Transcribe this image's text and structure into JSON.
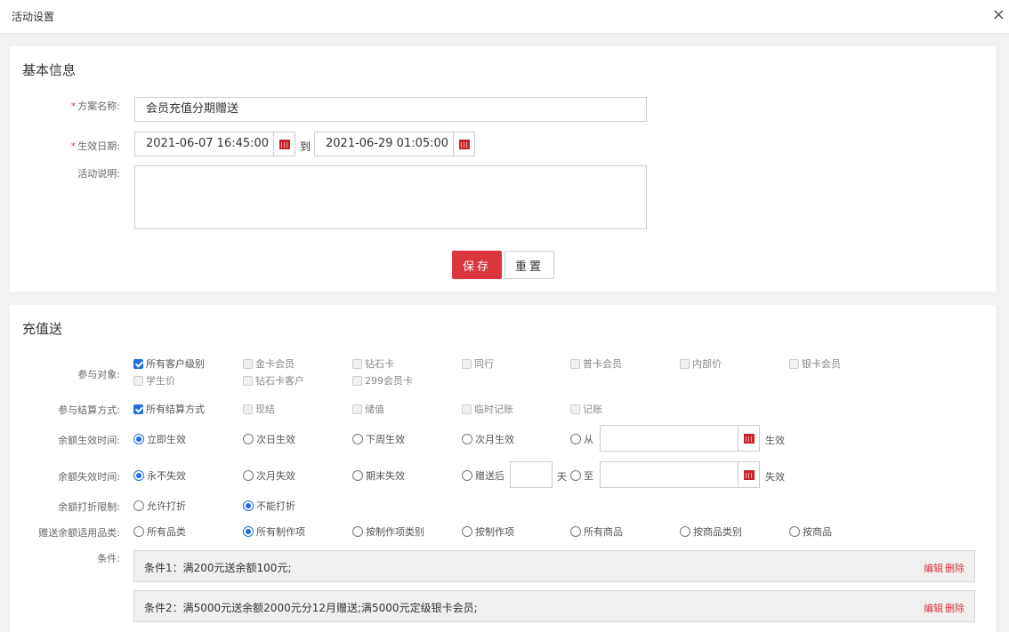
{
  "window": {
    "title": "活动设置",
    "close_glyph": "×"
  },
  "basic": {
    "section_title": "基本信息",
    "name_label": "方案名称:",
    "name_value": "会员充值分期赠送",
    "date_label": "生效日期:",
    "start_date": "2021-06-07 16:45:00",
    "to_text": "到",
    "end_date": "2021-06-29 01:05:00",
    "desc_label": "活动说明:",
    "save_label": "保存",
    "reset_label": "重置",
    "required_mark": "*"
  },
  "recharge": {
    "section_title": "充值送",
    "participants_label": "参与对象:",
    "participants": [
      {
        "label": "所有客户级别",
        "checked": true,
        "disabled": false
      },
      {
        "label": "金卡会员",
        "checked": false,
        "disabled": true
      },
      {
        "label": "钻石卡",
        "checked": false,
        "disabled": true
      },
      {
        "label": "同行",
        "checked": false,
        "disabled": true
      },
      {
        "label": "普卡会员",
        "checked": false,
        "disabled": true
      },
      {
        "label": "内部价",
        "checked": false,
        "disabled": true
      },
      {
        "label": "银卡会员",
        "checked": false,
        "disabled": true
      },
      {
        "label": "学生价",
        "checked": false,
        "disabled": true
      },
      {
        "label": "钻石卡客户",
        "checked": false,
        "disabled": true
      },
      {
        "label": "299会员卡",
        "checked": false,
        "disabled": true
      }
    ],
    "settlement_label": "参与结算方式:",
    "settlement": [
      {
        "label": "所有结算方式",
        "checked": true,
        "disabled": false
      },
      {
        "label": "现结",
        "checked": false,
        "disabled": true
      },
      {
        "label": "储值",
        "checked": false,
        "disabled": true
      },
      {
        "label": "临时记账",
        "checked": false,
        "disabled": true
      },
      {
        "label": "记账",
        "checked": false,
        "disabled": true
      }
    ],
    "effective_label": "余额生效时间:",
    "effective_options": [
      {
        "label": "立即生效",
        "checked": true
      },
      {
        "label": "次日生效",
        "checked": false
      },
      {
        "label": "下周生效",
        "checked": false
      },
      {
        "label": "次月生效",
        "checked": false
      },
      {
        "label": "从",
        "checked": false
      }
    ],
    "effective_suffix": "生效",
    "expire_label": "余额失效时间:",
    "expire_options": [
      {
        "label": "永不失效",
        "checked": true
      },
      {
        "label": "次月失效",
        "checked": false
      },
      {
        "label": "期末失效",
        "checked": false
      },
      {
        "label": "赠送后",
        "checked": false
      },
      {
        "label": "至",
        "checked": false
      }
    ],
    "expire_days_unit": "天",
    "expire_suffix": "失效",
    "discount_label": "余额打折限制:",
    "discount_options": [
      {
        "label": "允许打折",
        "checked": false
      },
      {
        "label": "不能打折",
        "checked": true
      }
    ],
    "category_label": "赠送余额适用品类:",
    "category_options": [
      {
        "label": "所有品类",
        "checked": false
      },
      {
        "label": "所有制作项",
        "checked": true
      },
      {
        "label": "按制作项类别",
        "checked": false
      },
      {
        "label": "按制作项",
        "checked": false
      },
      {
        "label": "所有商品",
        "checked": false
      },
      {
        "label": "按商品类别",
        "checked": false
      },
      {
        "label": "按商品",
        "checked": false
      }
    ],
    "conditions_label": "条件:",
    "conditions": [
      {
        "text": "条件1：满200元送余额100元;",
        "edit": "编辑",
        "delete": "删除"
      },
      {
        "text": "条件2：满5000元送余额2000元分12月赠送;满5000元定级银卡会员;",
        "edit": "编辑",
        "delete": "删除"
      }
    ]
  },
  "colors": {
    "primary_red": "#d9363e",
    "checked_blue": "#1f6fde",
    "calendar_red": "#c9242b"
  }
}
